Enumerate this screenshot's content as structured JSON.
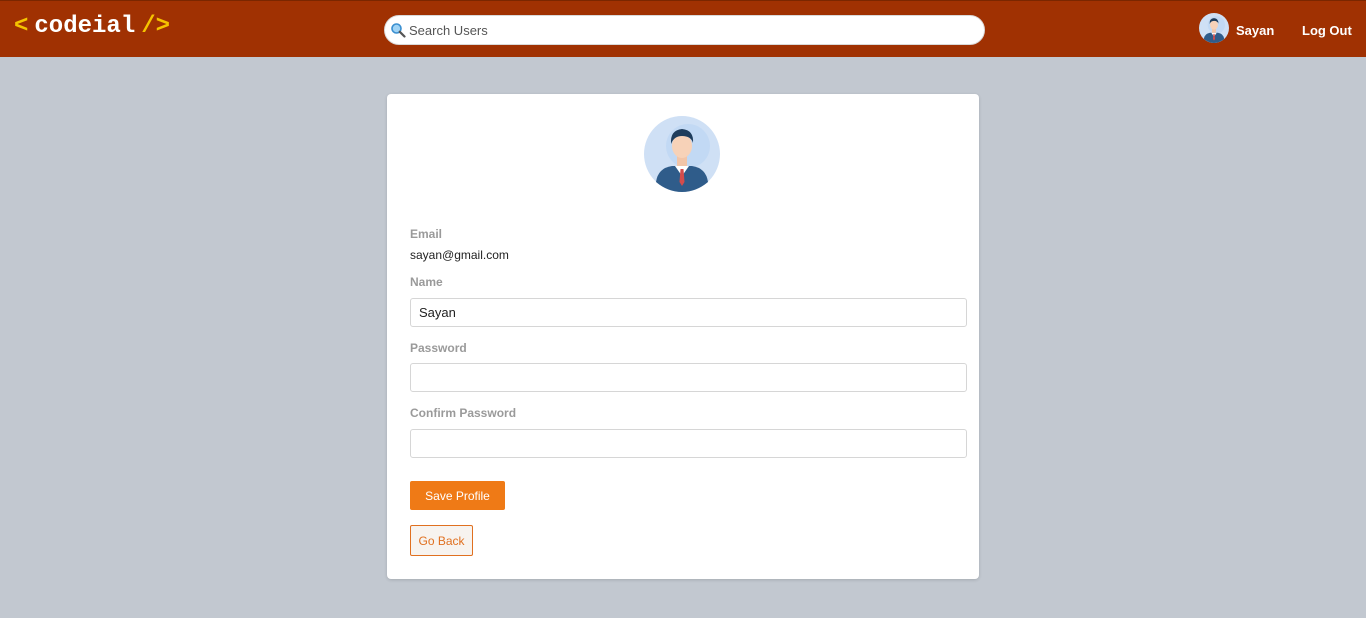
{
  "navbar": {
    "logo": {
      "open_bracket": "<",
      "name": "codeial",
      "close_bracket": "/>"
    },
    "search": {
      "placeholder": "Search Users",
      "value": "",
      "icon": "magnifier-icon"
    },
    "user": {
      "avatar_icon": "user-avatar-icon",
      "name": "Sayan"
    },
    "logout_label": "Log Out"
  },
  "profile": {
    "avatar_icon": "user-avatar-icon",
    "email_label": "Email",
    "email_value": "sayan@gmail.com",
    "name_label": "Name",
    "name_value": "Sayan",
    "password_label": "Password",
    "password_value": "",
    "confirm_password_label": "Confirm Password",
    "confirm_password_value": "",
    "save_button_label": "Save Profile",
    "back_button_label": "Go Back"
  },
  "colors": {
    "navbar_bg": "#a03102",
    "logo_bracket": "#f5c400",
    "page_bg": "#c2c8d0",
    "save_button_bg": "#ef7a16",
    "back_button_border": "#e07020"
  }
}
